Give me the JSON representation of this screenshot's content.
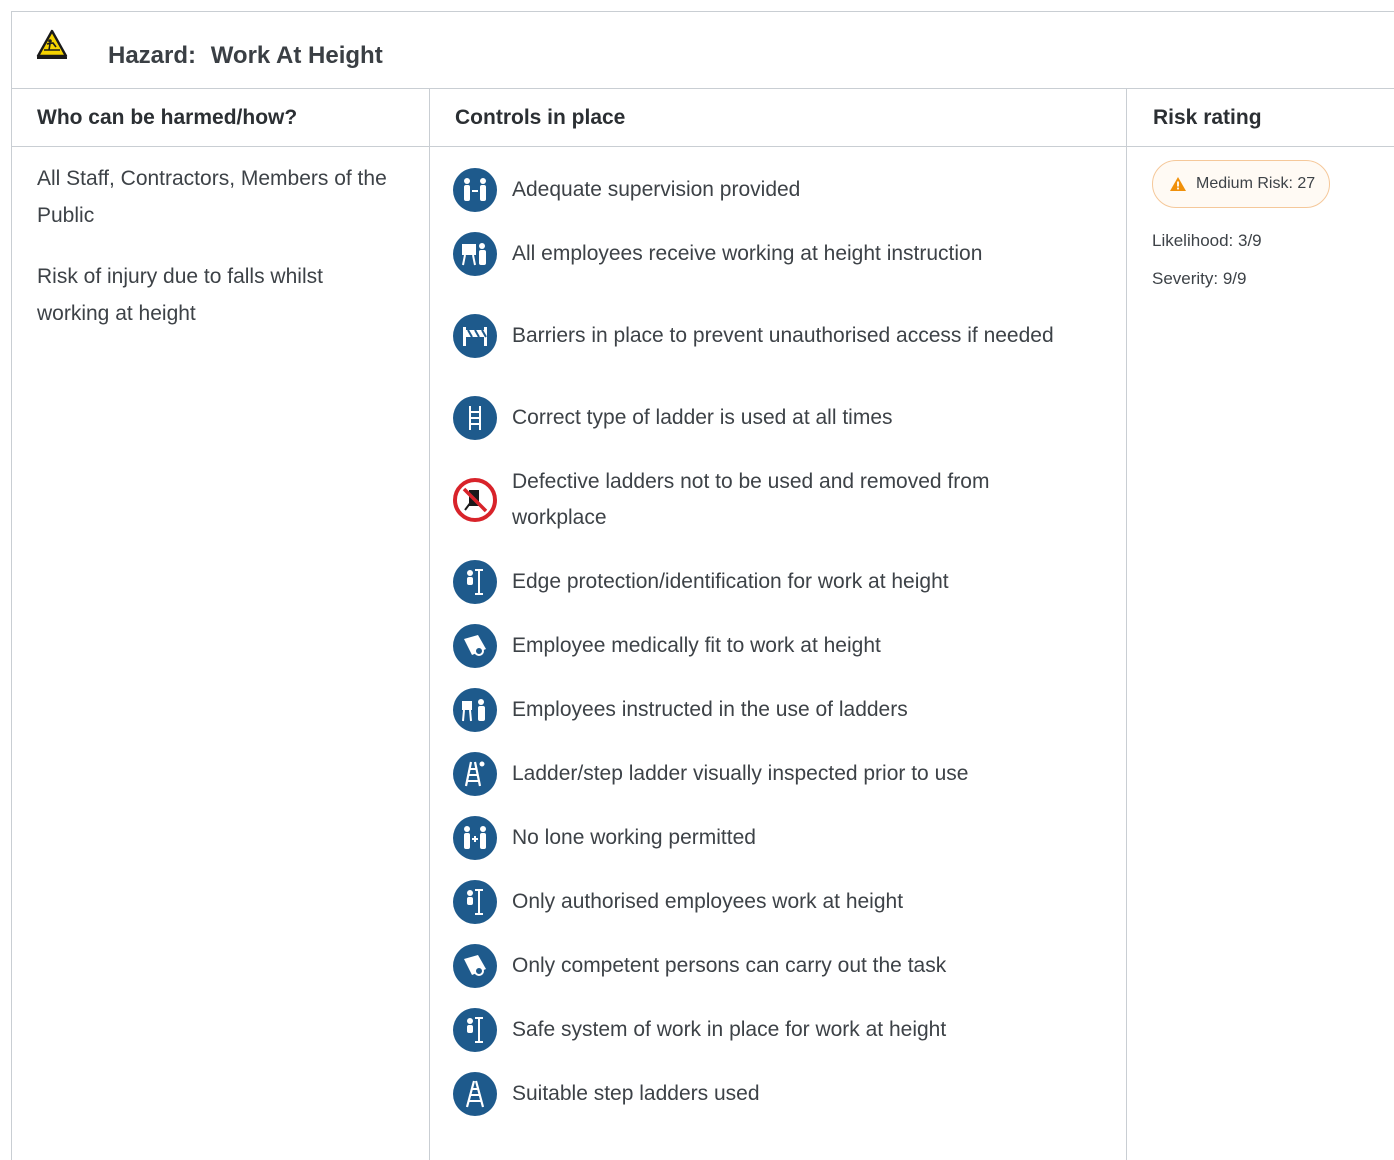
{
  "hazard": {
    "label": "Hazard:",
    "name": "Work At Height",
    "icon": "fall-hazard-warning-icon"
  },
  "columns": {
    "who": "Who can be harmed/how?",
    "controls": "Controls in place",
    "risk": "Risk rating"
  },
  "who": {
    "people": "All Staff, Contractors, Members of the Public",
    "how": "Risk of injury due to falls whilst working at height"
  },
  "controls": [
    {
      "text": "Adequate supervision provided",
      "icon": "supervision-icon"
    },
    {
      "text": "All employees receive working at height instruction",
      "icon": "instruction-icon"
    },
    {
      "text": "Barriers in place to prevent unauthorised access if needed",
      "icon": "barrier-icon"
    },
    {
      "text": "Correct type of ladder is used at all times",
      "icon": "ladder-icon"
    },
    {
      "text": "Defective ladders not to be used and removed from workplace",
      "icon": "no-defective-ladder-icon"
    },
    {
      "text": "Edge protection/identification for work at height",
      "icon": "harness-icon"
    },
    {
      "text": "Employee medically fit to work at height",
      "icon": "certificate-icon"
    },
    {
      "text": "Employees instructed in the use of ladders",
      "icon": "training-icon"
    },
    {
      "text": "Ladder/step ladder visually inspected prior to use",
      "icon": "step-ladder-inspect-icon"
    },
    {
      "text": "No lone working permitted",
      "icon": "no-lone-working-icon"
    },
    {
      "text": "Only authorised employees work at height",
      "icon": "harness-icon"
    },
    {
      "text": "Only competent persons can carry out the task",
      "icon": "certificate-icon"
    },
    {
      "text": "Safe system of work in place for work at height",
      "icon": "harness-icon"
    },
    {
      "text": "Suitable step ladders used",
      "icon": "step-ladder-icon"
    }
  ],
  "risk": {
    "badge": "Medium Risk: 27",
    "likelihood": "Likelihood: 3/9",
    "severity": "Severity: 9/9",
    "badge_color": "#f0900a"
  },
  "colors": {
    "icon_blue": "#1e5a8c",
    "border": "#c9ced3",
    "prohibition_red": "#d8232a"
  }
}
